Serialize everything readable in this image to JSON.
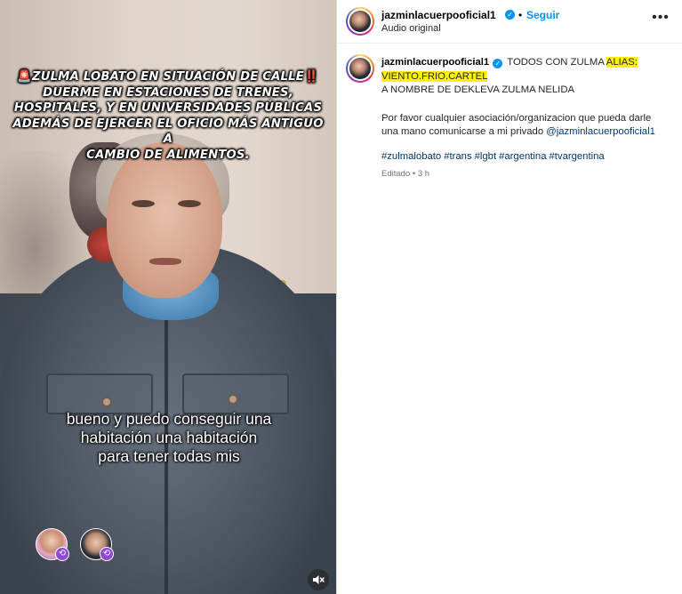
{
  "video": {
    "headline_emoji_start": "🚨",
    "headline_line1": "ZULMA LOBATO EN SITUACIÓN DE CALLE",
    "headline_emoji_end": "‼️",
    "headline_line2": "DUERME EN ESTACIONES DE TRENES,",
    "headline_line3": "HOSPITALES, Y EN UNIVERSIDADES PÚBLICAS",
    "headline_line4": "ADEMÁS DE EJERCER EL OFICIO MÁS ANTIGUO A",
    "headline_line5": "CAMBIO DE ALIMENTOS.",
    "subtitle_line1": "bueno y puedo conseguir una",
    "subtitle_line2": "habitación una habitación",
    "subtitle_line3": "para tener todas mis",
    "mute_icon": "speaker-muted-icon",
    "collab_icon": "collab-arrows-icon"
  },
  "post": {
    "username": "jazminlacuerpooficial1",
    "follow_label": "Seguir",
    "separator": "•",
    "audio_label": "Audio original",
    "more_icon": "•••",
    "caption": {
      "intro": "TODOS CON ZULMA",
      "alias_label": "ALIAS:",
      "alias_value": "VIENTO.FRIO.CARTEL",
      "line2": "A NOMBRE DE DEKLEVA ZULMA NELIDA",
      "paragraph": "Por favor cualquier asociación/organizacion que pueda darle una mano comunicarse a mi privado",
      "mention": "@jazminlacuerpooficial1",
      "hashtags": [
        "#zulmalobato",
        "#trans",
        "#lgbt",
        "#argentina",
        "#tvargentina"
      ],
      "edited": "Editado",
      "time": "3 h"
    },
    "accent_color": "#0095f6",
    "highlight_color": "#fff200"
  }
}
